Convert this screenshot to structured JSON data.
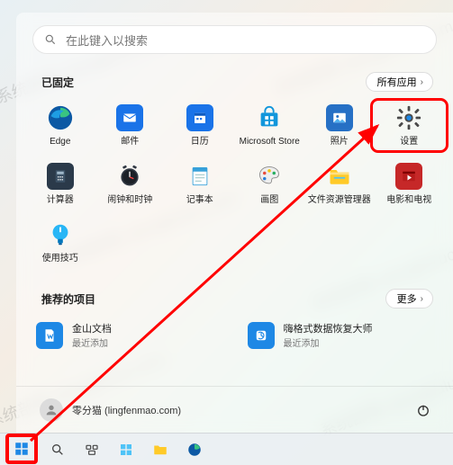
{
  "search": {
    "placeholder": "在此键入以搜索"
  },
  "pinned": {
    "title": "已固定",
    "all_apps_label": "所有应用",
    "apps": [
      {
        "id": "edge",
        "label": "Edge"
      },
      {
        "id": "mail",
        "label": "邮件"
      },
      {
        "id": "calendar",
        "label": "日历"
      },
      {
        "id": "store",
        "label": "Microsoft Store"
      },
      {
        "id": "photos",
        "label": "照片"
      },
      {
        "id": "settings",
        "label": "设置"
      },
      {
        "id": "calculator",
        "label": "计算器"
      },
      {
        "id": "clock",
        "label": "闹钟和时钟"
      },
      {
        "id": "notepad",
        "label": "记事本"
      },
      {
        "id": "paint",
        "label": "画图"
      },
      {
        "id": "explorer",
        "label": "文件资源管理器"
      },
      {
        "id": "movies",
        "label": "电影和电视"
      },
      {
        "id": "tips",
        "label": "使用技巧"
      }
    ]
  },
  "recommended": {
    "title": "推荐的项目",
    "more_label": "更多",
    "items": [
      {
        "title": "金山文档",
        "sub": "最近添加"
      },
      {
        "title": "嗨格式数据恢复大师",
        "sub": "最近添加"
      }
    ]
  },
  "user": {
    "display": "零分猫 (lingfenmao.com)"
  },
  "watermarks": [
    "系统部落 xitongbuluo.com",
    "系统部落 xitongbuluo.com",
    "系统部落 xitongbuluo.com"
  ]
}
